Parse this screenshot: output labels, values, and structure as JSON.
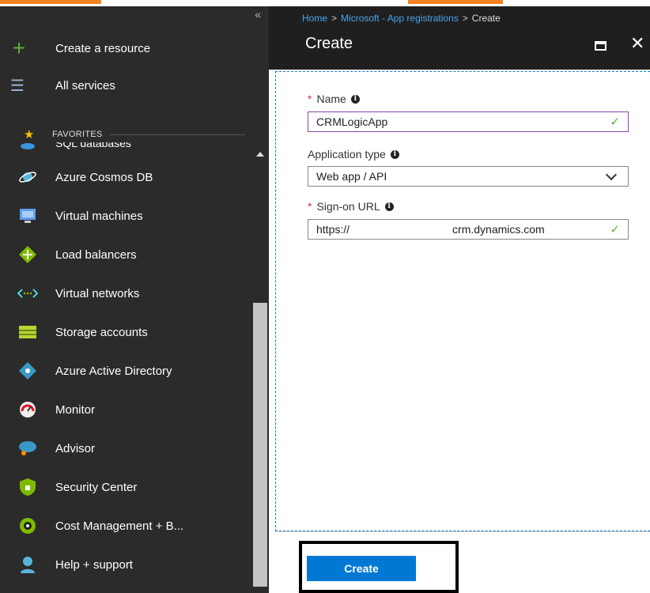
{
  "sidebar": {
    "collapse_glyph": "«",
    "create_resource": {
      "label": "Create a resource",
      "icon": "plus-icon"
    },
    "all_services": {
      "label": "All services",
      "icon": "list-icon"
    },
    "favorites_label": "FAVORITES",
    "cut_item": {
      "label": "SQL databases",
      "icon": "sql-database-icon"
    },
    "items": [
      {
        "label": "Azure Cosmos DB",
        "icon": "cosmos-db-icon"
      },
      {
        "label": "Virtual machines",
        "icon": "virtual-machine-icon"
      },
      {
        "label": "Load balancers",
        "icon": "load-balancer-icon"
      },
      {
        "label": "Virtual networks",
        "icon": "virtual-network-icon"
      },
      {
        "label": "Storage accounts",
        "icon": "storage-account-icon"
      },
      {
        "label": "Azure Active Directory",
        "icon": "active-directory-icon"
      },
      {
        "label": "Monitor",
        "icon": "monitor-icon"
      },
      {
        "label": "Advisor",
        "icon": "advisor-icon"
      },
      {
        "label": "Security Center",
        "icon": "security-center-icon"
      },
      {
        "label": "Cost Management + B...",
        "icon": "cost-management-icon"
      },
      {
        "label": "Help + support",
        "icon": "help-support-icon"
      }
    ]
  },
  "blade": {
    "breadcrumb": [
      {
        "label": "Home"
      },
      {
        "label": "Microsoft - App registrations"
      },
      {
        "label": "Create"
      }
    ],
    "title": "Create",
    "name_label": "Name",
    "name_value": "CRMLogicApp",
    "app_type_label": "Application type",
    "app_type_value": "Web app / API",
    "signon_label": "Sign-on URL",
    "signon_prefix": "https://",
    "signon_suffix": "crm.dynamics.com",
    "required_mark": "*",
    "info_glyph": "i",
    "check_glyph": "✓",
    "create_button": "Create"
  },
  "colors": {
    "accent": "#0078d4",
    "sidebar_bg": "#2b2b2b",
    "header_bg": "#1f1f1f",
    "valid_check": "#5bb12f",
    "required": "#d13438",
    "top_strip_orange": "#f58220"
  }
}
